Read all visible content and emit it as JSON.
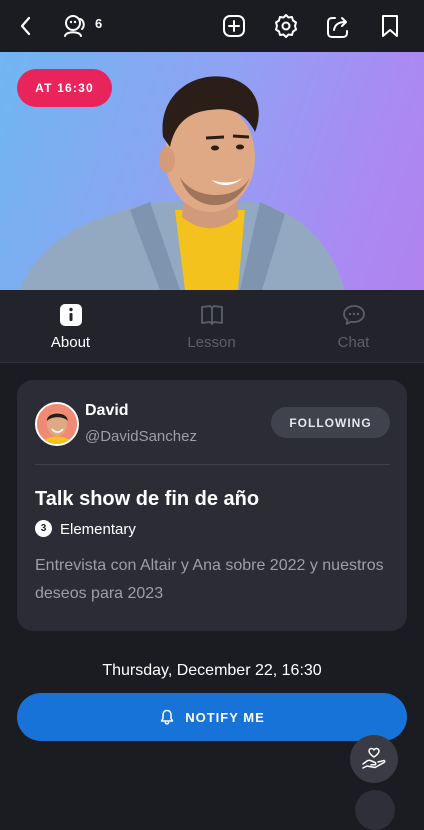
{
  "topbar": {
    "viewer_count": "6",
    "icons": [
      "chevron-left-icon",
      "viewers-icon",
      "plus-square-icon",
      "gear-icon",
      "share-icon",
      "bookmark-icon"
    ]
  },
  "hero": {
    "time_badge": "AT 16:30"
  },
  "tabs": [
    {
      "label": "About",
      "icon": "info-icon",
      "active": true
    },
    {
      "label": "Lesson",
      "icon": "book-icon",
      "active": false
    },
    {
      "label": "Chat",
      "icon": "chat-icon",
      "active": false
    }
  ],
  "host": {
    "name": "David",
    "handle": "@DavidSanchez",
    "follow_label": "FOLLOWING"
  },
  "event": {
    "title": "Talk show de fin de año",
    "level_number": "3",
    "level_label": "Elementary",
    "description": "Entrevista con Altair y Ana sobre 2022 y nuestros deseos para 2023",
    "date": "Thursday, December 22, 16:30"
  },
  "actions": {
    "notify_label": "NOTIFY ME"
  },
  "colors": {
    "accent_blue": "#1873d8",
    "badge_red": "#e8245a",
    "background": "#1b1c22",
    "card": "#2b2c35"
  }
}
